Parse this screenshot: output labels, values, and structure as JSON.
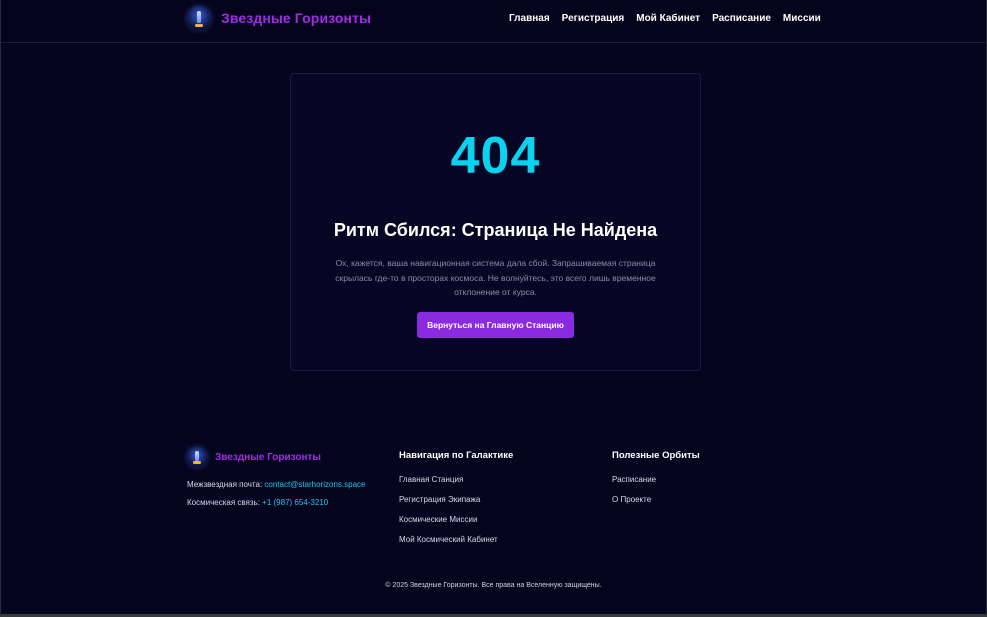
{
  "header": {
    "brand_name": "Звездные Горизонты",
    "nav": [
      {
        "label": "Главная"
      },
      {
        "label": "Регистрация"
      },
      {
        "label": "Мой Кабинет"
      },
      {
        "label": "Расписание"
      },
      {
        "label": "Миссии"
      }
    ]
  },
  "error": {
    "code": "404",
    "title": "Ритм Сбился: Страница Не Найдена",
    "message": "Ох, кажется, ваша навигационная система дала сбой. Запрашиваемая страница скрылась где-то в просторах космоса. Не волнуйтесь, это всего лишь временное отклонение от курса.",
    "button_label": "Вернуться на Главную Станцию"
  },
  "footer": {
    "brand_name": "Звездные Горизонты",
    "email_label": "Межзвездная почта:",
    "email": "contact@starhorizons.space",
    "phone_label": "Космическая связь:",
    "phone": "+1 (987) 654-3210",
    "nav_heading": "Навигация по Галактике",
    "nav_links": [
      {
        "label": "Главная Станция"
      },
      {
        "label": "Регистрация Экипажа"
      },
      {
        "label": "Космические Миссии"
      },
      {
        "label": "Мой Космический Кабинет"
      }
    ],
    "orbits_heading": "Полезные Орбиты",
    "orbit_links": [
      {
        "label": "Расписание"
      },
      {
        "label": "О Проекте"
      }
    ],
    "copyright": "© 2025 Звездные Горизонты. Все права на Вселенную защищены."
  },
  "colors": {
    "background": "#06051f",
    "brand": "#a02ce6",
    "accent_cyan": "#0ad3f0",
    "button": "#8a2be2"
  },
  "icons": {
    "logo": "rocket-planet-logo-icon"
  }
}
